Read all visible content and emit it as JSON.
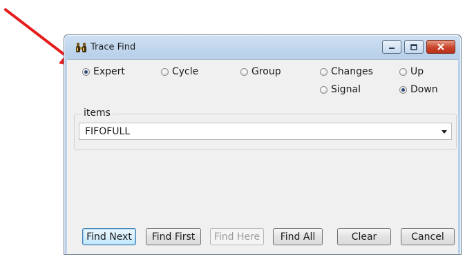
{
  "window": {
    "title": "Trace Find"
  },
  "mode_options": [
    {
      "label": "Expert",
      "checked": true
    },
    {
      "label": "Cycle",
      "checked": false
    },
    {
      "label": "Group",
      "checked": false
    },
    {
      "label": "Changes",
      "checked": false
    },
    {
      "label": "Signal",
      "checked": false
    }
  ],
  "direction_options": [
    {
      "label": "Up",
      "checked": false
    },
    {
      "label": "Down",
      "checked": true
    }
  ],
  "items_group": {
    "label": "items",
    "selected_value": "FIFOFULL"
  },
  "buttons": {
    "find_next": "Find Next",
    "find_first": "Find First",
    "find_here": "Find Here",
    "find_all": "Find All",
    "clear": "Clear",
    "cancel": "Cancel"
  },
  "colors": {
    "annotation_arrow": "#e41e1e"
  },
  "icons": {
    "title": "binoculars-icon",
    "minimize": "minimize-icon",
    "maximize": "maximize-icon",
    "close": "close-icon",
    "dropdown": "chevron-down-icon"
  }
}
